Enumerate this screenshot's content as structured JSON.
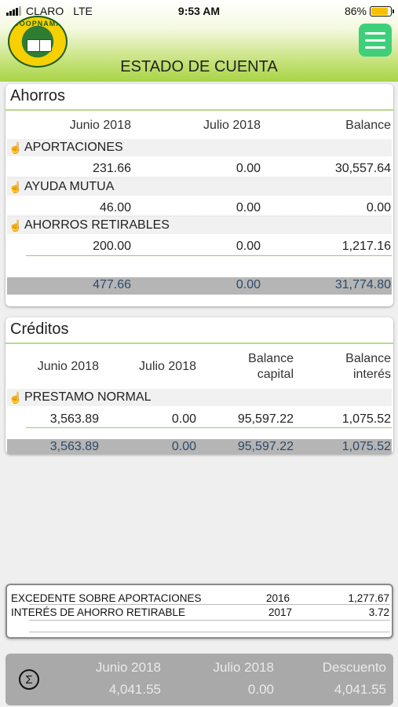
{
  "status_bar": {
    "carrier": "CLARO",
    "network": "LTE",
    "time": "9:53 AM",
    "battery_percent": "86%",
    "battery_level": 0.86
  },
  "header": {
    "logo_text": "COOPNAMA",
    "title": "ESTADO DE CUENTA",
    "menu_icon": "hamburger-menu-icon"
  },
  "ahorros": {
    "title": "Ahorros",
    "columns": [
      "Junio 2018",
      "Julio 2018",
      "Balance"
    ],
    "items": [
      {
        "name": "APORTACIONES",
        "values": [
          "231.66",
          "0.00",
          "30,557.64"
        ]
      },
      {
        "name": "AYUDA MUTUA",
        "values": [
          "46.00",
          "0.00",
          "0.00"
        ]
      },
      {
        "name": "AHORROS RETIRABLES",
        "values": [
          "200.00",
          "0.00",
          "1,217.16"
        ]
      }
    ],
    "totals": [
      "477.66",
      "0.00",
      "31,774.80"
    ]
  },
  "creditos": {
    "title": "Créditos",
    "columns": [
      "Junio 2018",
      "Julio 2018",
      "Balance capital",
      "Balance interés"
    ],
    "column_lines": [
      [
        "Junio 2018"
      ],
      [
        "Julio 2018"
      ],
      [
        "Balance",
        "capital"
      ],
      [
        "Balance",
        "interés"
      ]
    ],
    "items": [
      {
        "name": "PRESTAMO NORMAL",
        "values": [
          "3,563.89",
          "0.00",
          "95,597.22",
          "1,075.52"
        ]
      }
    ],
    "totals": [
      "3,563.89",
      "0.00",
      "95,597.22",
      "1,075.52"
    ]
  },
  "excedentes": [
    {
      "label": "EXCEDENTE SOBRE APORTACIONES",
      "year": "2016",
      "amount": "1,277.67"
    },
    {
      "label": "INTERÉS DE AHORRO RETIRABLE",
      "year": "2017",
      "amount": "3.72"
    }
  ],
  "summary": {
    "icon": "sigma-icon",
    "columns": [
      "Junio 2018",
      "Julio 2018",
      "Descuento"
    ],
    "values": [
      "4,041.55",
      "0.00",
      "4,041.55"
    ]
  },
  "colors": {
    "accent_green": "#a9d447",
    "menu_green": "#3fcf7b",
    "total_bar": "#b5b5b5",
    "icon_blue": "#2a8bd6"
  }
}
